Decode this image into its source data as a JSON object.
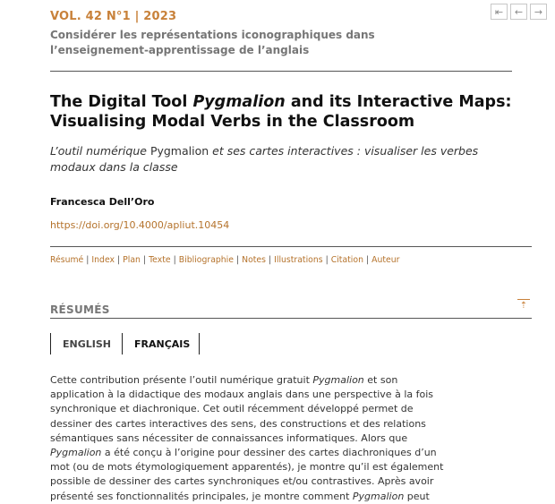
{
  "header": {
    "volume": "VOL. 42 N°1 | 2023",
    "issue_title": "Considérer les représentations iconographiques dans l’enseignement-apprentissage de l’anglais"
  },
  "nav": {
    "first": "⇤",
    "prev": "←",
    "next": "→"
  },
  "article": {
    "title_part1": "The Digital Tool ",
    "title_italic": "Pygmalion",
    "title_part2": " and its Interactive Maps: Visualising Modal Verbs in the Classroom",
    "alt_title_part1": "L’outil numérique ",
    "alt_title_upright": "Pygmalion",
    "alt_title_part2": " et ses cartes interactives : visualiser les verbes modaux dans la classe",
    "author": "Francesca Dell’Oro",
    "doi": "https://doi.org/10.4000/apliut.10454"
  },
  "toc": [
    "Résumé",
    "Index",
    "Plan",
    "Texte",
    "Bibliographie",
    "Notes",
    "Illustrations",
    "Citation",
    "Auteur"
  ],
  "toc_separator": "|",
  "resumes": {
    "heading": "RÉSUMÉS",
    "back_to_top": "⇡",
    "tabs": {
      "english": "ENGLISH",
      "francais": "FRANÇAIS"
    },
    "abstract": {
      "s1": "Cette contribution présente l’outil numérique gratuit ",
      "i1": "Pygmalion",
      "s2": " et son application à la didactique des modaux anglais dans une perspective à la fois synchronique et diachronique. Cet outil récemment développé permet de dessiner des cartes interactives des sens, des constructions et des relations sémantiques sans nécessiter de connaissances informatiques. Alors que ",
      "i2": "Pygmalion",
      "s3": " a été conçu à l’origine pour dessiner des cartes diachroniques d’un mot (ou de mots étymologiquement apparentés), je montre qu’il est également possible de dessiner des cartes synchroniques et/ou contrastives. Après avoir présenté ses fonctionnalités principales, je montre comment ",
      "i3": "Pygmalion",
      "s4": " peut"
    }
  }
}
